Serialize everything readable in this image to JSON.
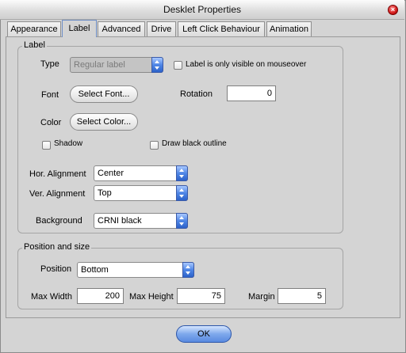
{
  "window": {
    "title": "Desklet Properties"
  },
  "tabs": [
    "Appearance",
    "Label",
    "Advanced",
    "Drive",
    "Left Click Behaviour",
    "Animation"
  ],
  "label_group": {
    "title": "Label",
    "type_label": "Type",
    "type_value": "Regular label",
    "mouseover_label": "Label is only visible on mouseover",
    "font_label": "Font",
    "font_button": "Select Font...",
    "rotation_label": "Rotation",
    "rotation_value": "0",
    "color_label": "Color",
    "color_button": "Select Color...",
    "shadow_label": "Shadow",
    "outline_label": "Draw black outline",
    "hor_align_label": "Hor. Alignment",
    "hor_align_value": "Center",
    "ver_align_label": "Ver. Alignment",
    "ver_align_value": "Top",
    "background_label": "Background",
    "background_value": "CRNI black"
  },
  "position_group": {
    "title": "Position and size",
    "position_label": "Position",
    "position_value": "Bottom",
    "max_width_label": "Max Width",
    "max_width_value": "200",
    "max_height_label": "Max Height",
    "max_height_value": "75",
    "margin_label": "Margin",
    "margin_value": "5"
  },
  "footer": {
    "ok_label": "OK"
  },
  "icons": {
    "close": "close-icon",
    "dropdown": "dropdown-arrow-icon"
  }
}
